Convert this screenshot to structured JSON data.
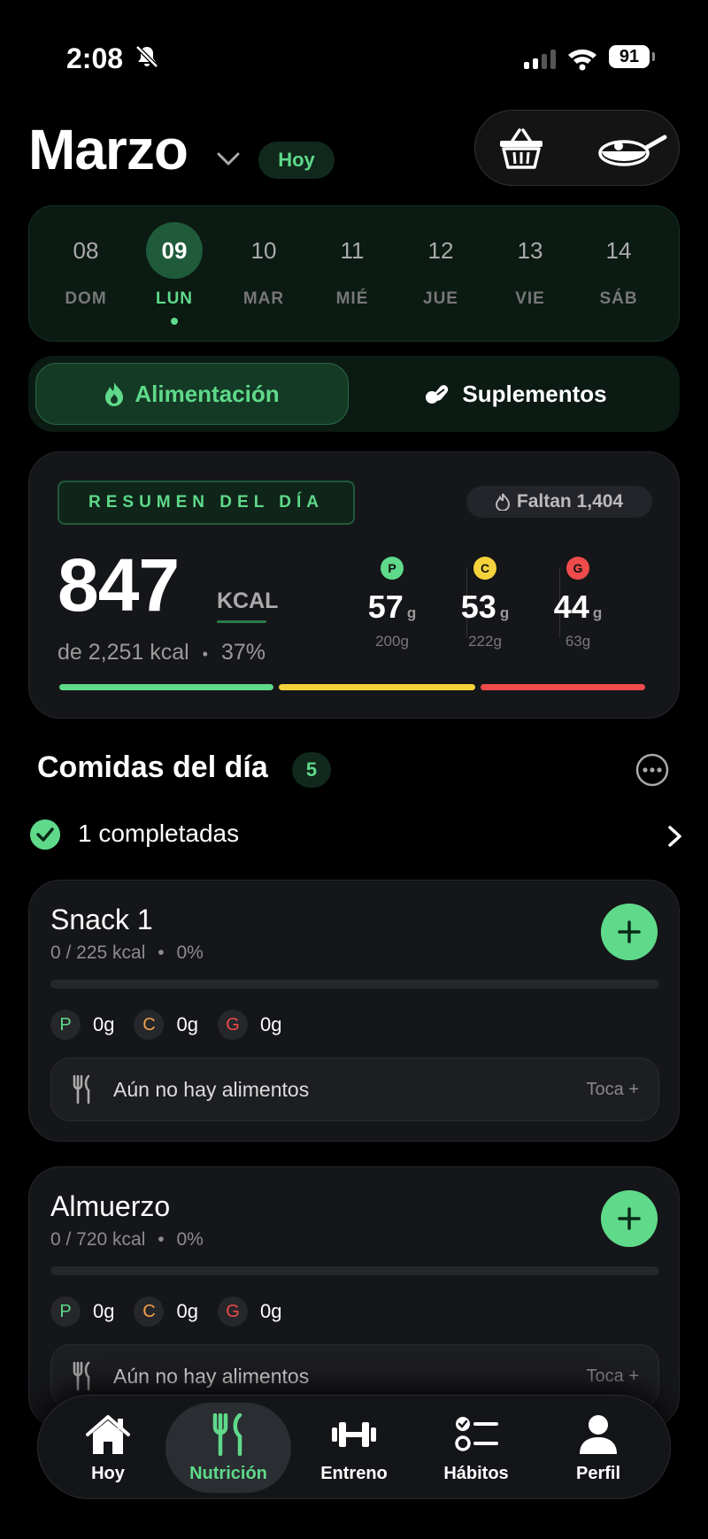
{
  "status": {
    "time": "2:08",
    "battery": "91"
  },
  "header": {
    "month": "Marzo",
    "today_pill": "Hoy"
  },
  "week": [
    {
      "num": "08",
      "label": "DOM"
    },
    {
      "num": "09",
      "label": "LUN",
      "active": true
    },
    {
      "num": "10",
      "label": "MAR"
    },
    {
      "num": "11",
      "label": "MIÉ"
    },
    {
      "num": "12",
      "label": "JUE"
    },
    {
      "num": "13",
      "label": "VIE"
    },
    {
      "num": "14",
      "label": "SÁB"
    }
  ],
  "segments": {
    "active": "Alimentación",
    "other": "Suplementos"
  },
  "summary": {
    "tag": "RESUMEN DEL DÍA",
    "remaining": "Faltan 1,404",
    "kcal": "847",
    "kcal_unit": "KCAL",
    "of_goal": "de 2,251 kcal",
    "sep": "•",
    "percent": "37%",
    "macros": [
      {
        "letter": "P",
        "value": "57",
        "unit": "g",
        "goal": "200g",
        "color": "#5fd98a"
      },
      {
        "letter": "C",
        "value": "53",
        "unit": "g",
        "goal": "222g",
        "color": "#f5d23c"
      },
      {
        "letter": "G",
        "value": "44",
        "unit": "g",
        "goal": "63g",
        "color": "#ef4b4b"
      }
    ]
  },
  "meals_header": {
    "title": "Comidas del día",
    "count": "5",
    "completed": "1 completadas"
  },
  "meals": [
    {
      "name": "Snack 1",
      "kcal": "0 / 225 kcal",
      "sep": "•",
      "percent": "0%",
      "p": "0g",
      "c": "0g",
      "g": "0g",
      "empty": "Aún no hay alimentos",
      "hint": "Toca +"
    },
    {
      "name": "Almuerzo",
      "kcal": "0 / 720 kcal",
      "sep": "•",
      "percent": "0%",
      "p": "0g",
      "c": "0g",
      "g": "0g",
      "empty": "Aún no hay alimentos",
      "hint": "Toca +"
    }
  ],
  "macro_letters": {
    "p": "P",
    "c": "C",
    "g": "G"
  },
  "tabs": [
    {
      "label": "Hoy",
      "icon": "house-icon"
    },
    {
      "label": "Nutrición",
      "icon": "fork-knife-icon",
      "active": true
    },
    {
      "label": "Entreno",
      "icon": "dumbbell-icon"
    },
    {
      "label": "Hábitos",
      "icon": "checklist-icon"
    },
    {
      "label": "Perfil",
      "icon": "person-icon"
    }
  ],
  "colors": {
    "accent": "#5fd98a",
    "protein": "#5fd98a",
    "carbs": "#f5d23c",
    "fat": "#ef4b4b",
    "background": "#000000",
    "card": "#151619"
  }
}
